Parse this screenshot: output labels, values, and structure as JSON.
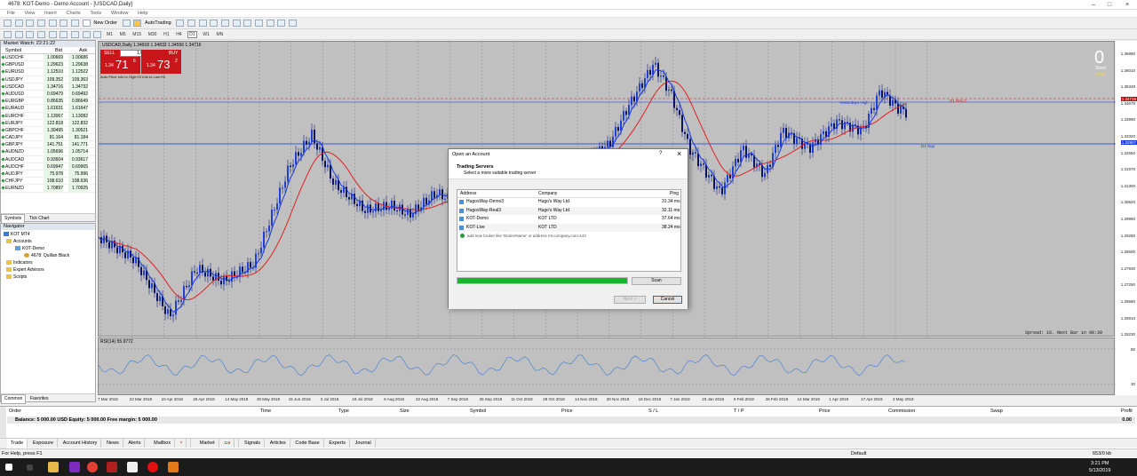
{
  "window": {
    "title": "4678: KOT-Demo - Demo Account - [USDCAD,Daily]"
  },
  "menu": [
    "File",
    "View",
    "Insert",
    "Charts",
    "Tools",
    "Window",
    "Help"
  ],
  "toolbar": {
    "new_order": "New Order",
    "autotrading": "AutoTrading",
    "timeframes": [
      "M1",
      "M5",
      "M15",
      "M30",
      "H1",
      "H4",
      "D1",
      "W1",
      "MN"
    ]
  },
  "market_watch": {
    "title": "Market Watch: 22:21:22",
    "headers": {
      "symbol": "Symbol",
      "bid": "Bid",
      "ask": "Ask"
    },
    "rows": [
      {
        "s": "USDCHF",
        "b": "1.00669",
        "a": "1.00686"
      },
      {
        "s": "GBPUSD",
        "b": "1.29623",
        "a": "1.29638"
      },
      {
        "s": "EURUSD",
        "b": "1.12510",
        "a": "1.12522"
      },
      {
        "s": "USDJPY",
        "b": "109.352",
        "a": "109.363"
      },
      {
        "s": "USDCAD",
        "b": "1.34716",
        "a": "1.34732"
      },
      {
        "s": "AUDUSD",
        "b": "0.69479",
        "a": "0.69492"
      },
      {
        "s": "EURGBP",
        "b": "0.86635",
        "a": "0.86649"
      },
      {
        "s": "EURAUD",
        "b": "1.61631",
        "a": "1.61647"
      },
      {
        "s": "EURCHF",
        "b": "1.13067",
        "a": "1.13082"
      },
      {
        "s": "EURJPY",
        "b": "122.818",
        "a": "122.832"
      },
      {
        "s": "GBPCHF",
        "b": "1.30495",
        "a": "1.30521"
      },
      {
        "s": "CADJPY",
        "b": "81.164",
        "a": "81.184"
      },
      {
        "s": "GBPJPY",
        "b": "141.751",
        "a": "141.771"
      },
      {
        "s": "AUDNZD",
        "b": "1.05696",
        "a": "1.05714"
      },
      {
        "s": "AUDCAD",
        "b": "0.93604",
        "a": "0.93617"
      },
      {
        "s": "AUDCHF",
        "b": "0.69947",
        "a": "0.69965"
      },
      {
        "s": "AUDJPY",
        "b": "75.978",
        "a": "75.996"
      },
      {
        "s": "CHFJPY",
        "b": "108.610",
        "a": "108.636"
      },
      {
        "s": "EURNZD",
        "b": "1.70897",
        "a": "1.70925"
      }
    ],
    "tabs": [
      "Symbols",
      "Tick Chart"
    ]
  },
  "navigator": {
    "title": "Navigator",
    "root": "KOT MT4",
    "accounts": "Accounts",
    "server": "KOT-Demo",
    "account": "4678: Quillan Black",
    "indicators": "Indicators",
    "experts": "Expert Advisors",
    "scripts": "Scripts",
    "tabs": [
      "Common",
      "Favorites"
    ]
  },
  "chart": {
    "header": "USDCAD,Daily  1.34918 1.34833 1.34556 1.34716",
    "sell": "SELL",
    "buy": "BUY",
    "lots": "1.00",
    "sell_price_small": "1.34",
    "sell_price_big": "71",
    "sell_price_sup": "6",
    "buy_price_small": "1.34",
    "buy_price_big": "73",
    "buy_price_sup": "2",
    "note": "Auto Price Info to High+Cl Info to Low+Hi",
    "count": "0",
    "short_label": "Short",
    "long_label": "Long",
    "label_yesterday": "Yesterdays High",
    "label_d1res": "D1 Res C",
    "label_d1sup": "D1 Sup",
    "spread": "Spread: 16. Next Bar in 90:39",
    "price_tag_current": "1.34716",
    "price_tag_sup": "1.32907",
    "y_labels": [
      "1.36880",
      "1.36010",
      "1.35349",
      "1.34678",
      "1.33990",
      "1.33320",
      "1.32650",
      "1.31970",
      "1.31300",
      "1.30620",
      "1.29950",
      "1.29280",
      "1.28600",
      "1.27930",
      "1.27250",
      "1.26580",
      "1.25910",
      "1.25230"
    ],
    "rsi_label": "RSI(14) 55.9772",
    "rsi_levels": [
      "80",
      "30"
    ],
    "x_labels": [
      "7 Mar 2018",
      "23 Mar 2018",
      "10 Apr 2018",
      "26 Apr 2018",
      "14 May 2018",
      "30 May 2018",
      "15 Jun 2018",
      "3 Jul 2018",
      "19 Jul 2018",
      "6 Aug 2018",
      "22 Aug 2018",
      "7 Sep 2018",
      "25 Sep 2018",
      "11 Oct 2018",
      "29 Oct 2018",
      "14 Nov 2018",
      "30 Nov 2018",
      "18 Dec 2018",
      "7 Jan 2019",
      "23 Jan 2019",
      "8 Feb 2019",
      "26 Feb 2019",
      "14 Mar 2019",
      "1 Apr 2019",
      "17 Apr 2019",
      "3 May 2019"
    ]
  },
  "dialog": {
    "title": "Open an Account",
    "help": "?",
    "close": "×",
    "heading": "Trading Servers",
    "sub": "Select a more suitable trading server",
    "cols": {
      "address": "Address",
      "company": "Company",
      "ping": "Ping"
    },
    "servers": [
      {
        "addr": "HugosWay-Demo3",
        "co": "Hugo's Way Ltd.",
        "ping": "31.34 ms"
      },
      {
        "addr": "HugosWay-Real3",
        "co": "Hugo's Way Ltd.",
        "ping": "32.11 ms"
      },
      {
        "addr": "KOT-Demo",
        "co": "KOT LTD",
        "ping": "37.64 ms"
      },
      {
        "addr": "KOT-Live",
        "co": "KOT LTD",
        "ping": "38.24 ms"
      }
    ],
    "add_broker": "add new broker like 'BrokerName' or address mt.company.com:443",
    "scan": "Scan",
    "next": "Next >",
    "cancel": "Cancel",
    "progress": 1.0
  },
  "terminal": {
    "headers": [
      "Order",
      "Time",
      "Type",
      "Size",
      "Symbol",
      "Price",
      "S / L",
      "T / P",
      "Price",
      "Commission",
      "Swap",
      "Profit"
    ],
    "balance": "Balance: 5 000.00 USD  Equity: 5 000.00  Free margin: 5 000.00",
    "profit": "0.00",
    "tabs": [
      "Trade",
      "Exposure",
      "Account History",
      "News",
      "Alerts",
      "Mailbox",
      "Market",
      "Signals",
      "Articles",
      "Code Base",
      "Experts",
      "Journal"
    ],
    "mailbox_badge": "7",
    "market_badge": "118",
    "side_label": "Terminal"
  },
  "status": {
    "help": "For Help, press F1",
    "profile": "Default",
    "traffic": "653/0 kb"
  },
  "taskbar": {
    "time": "3:21 PM",
    "date": "5/13/2019"
  },
  "colors": {
    "bull": "#1f3fd6",
    "bear": "#102080",
    "ma_red": "#e02020",
    "ma_blue": "#1638e0",
    "chart_bg": "#c0c0c0",
    "sell": "#c8161b",
    "progress": "#16b52b"
  }
}
